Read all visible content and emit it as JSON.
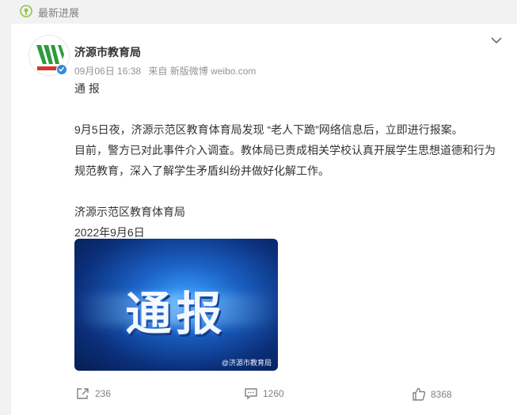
{
  "header": {
    "label": "最新进展",
    "icon": "location-pin-icon"
  },
  "post": {
    "author": "济源市教育局",
    "time": "09月06日 16:38",
    "source": "来自 新版微博 weibo.com",
    "title": "通 报",
    "paragraphs": [
      "9月5日夜，济源示范区教育体育局发现 “老人下跪”网络信息后，立即进行报案。",
      "目前，警方已对此事件介入调查。教体局已责成相关学校认真开展学生思想道德和行为",
      "规范教育，深入了解学生矛盾纠纷并做好化解工作。"
    ],
    "signature": "济源示范区教育体育局",
    "date": "2022年9月6日",
    "image": {
      "text": "通报",
      "watermark": "@济源市教育局"
    }
  },
  "actions": {
    "repost": "236",
    "comment": "1260",
    "like": "8368"
  },
  "colors": {
    "accent": "#8cc63f",
    "verified": "#2f8bdb",
    "meta": "#939393"
  }
}
